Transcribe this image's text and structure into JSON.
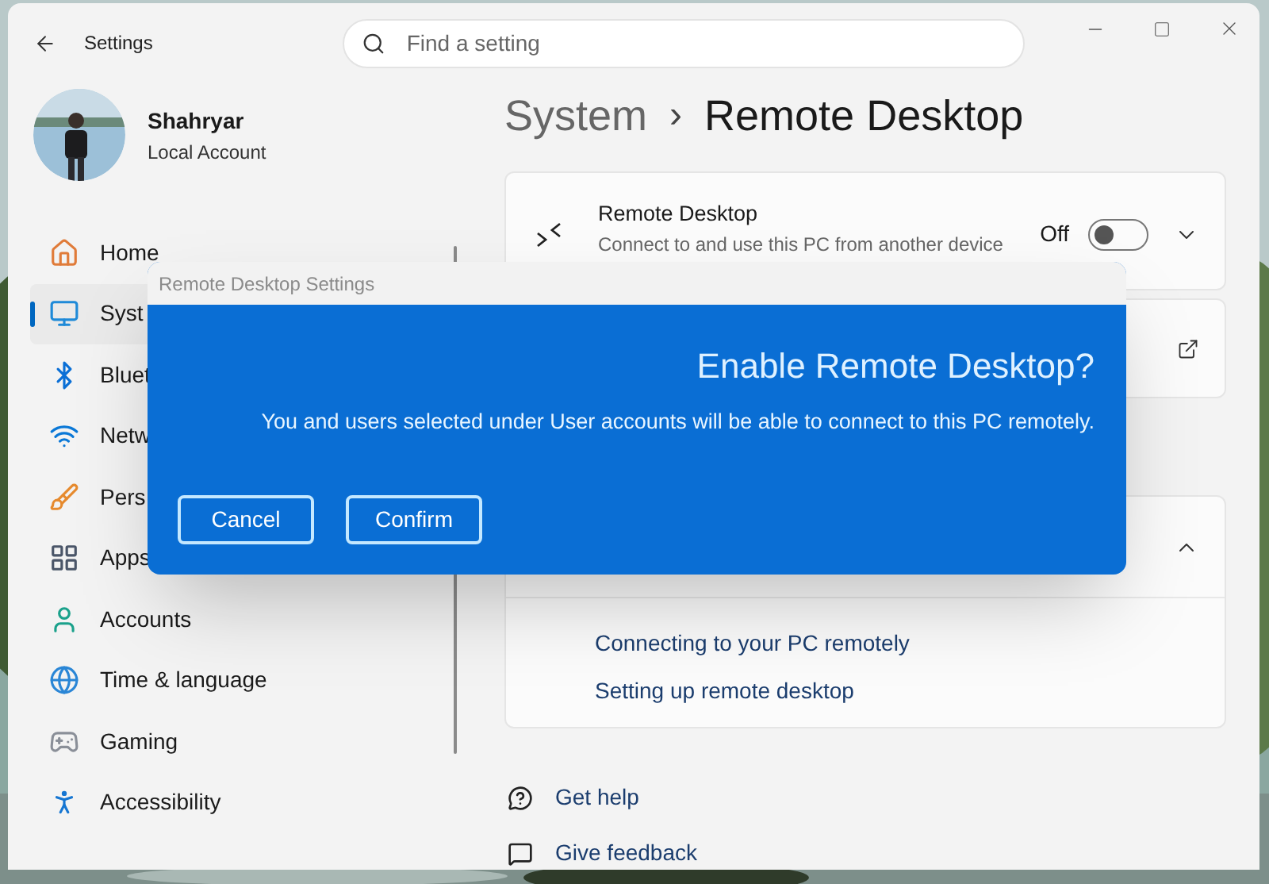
{
  "window": {
    "title": "Settings"
  },
  "search": {
    "placeholder": "Find a setting"
  },
  "account": {
    "name": "Shahryar",
    "type": "Local Account"
  },
  "sidebar": {
    "items": [
      {
        "label": "Home",
        "selected": false
      },
      {
        "label": "Syst",
        "selected": true
      },
      {
        "label": "Bluet",
        "selected": false
      },
      {
        "label": "Netw",
        "selected": false
      },
      {
        "label": "Pers",
        "selected": false
      },
      {
        "label": "Apps",
        "selected": false
      },
      {
        "label": "Accounts",
        "selected": false
      },
      {
        "label": "Time & language",
        "selected": false
      },
      {
        "label": "Gaming",
        "selected": false
      },
      {
        "label": "Accessibility",
        "selected": false
      }
    ]
  },
  "breadcrumb": {
    "parent": "System",
    "separator": "›",
    "current": "Remote Desktop"
  },
  "remote_desktop": {
    "title": "Remote Desktop",
    "description": "Connect to and use this PC from another device",
    "state_label": "Off",
    "on": false,
    "expanded": false
  },
  "related": {
    "expanded": true,
    "links": [
      "Connecting to your PC remotely",
      "Setting up remote desktop"
    ]
  },
  "footer_links": [
    "Get help",
    "Give feedback"
  ],
  "dialog": {
    "title": "Remote Desktop Settings",
    "heading": "Enable Remote Desktop?",
    "message": "You and users selected under User accounts will be able to connect to this PC remotely.",
    "buttons": [
      "Cancel",
      "Confirm"
    ]
  }
}
